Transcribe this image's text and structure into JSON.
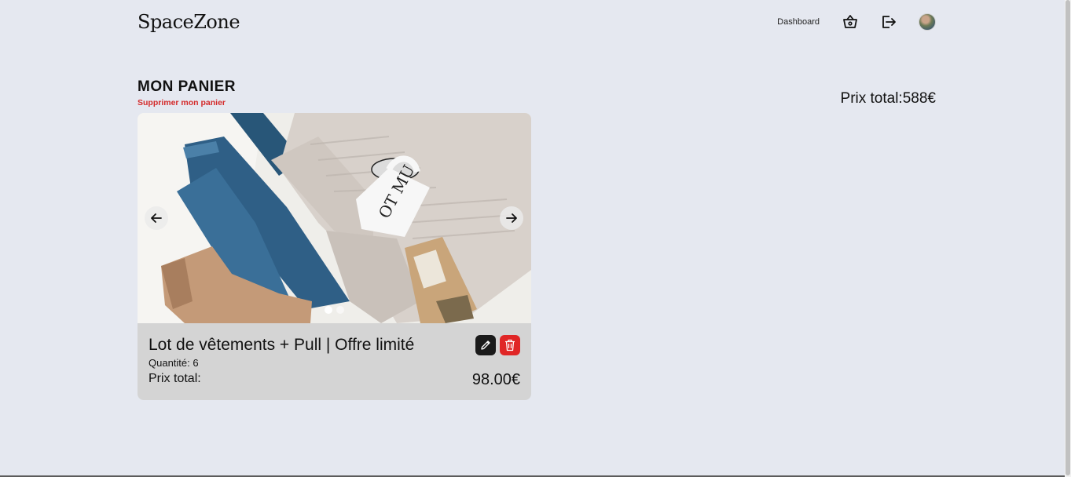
{
  "header": {
    "logo": "SpaceZone",
    "nav": {
      "dashboard_label": "Dashboard"
    },
    "icons": [
      "basket-icon",
      "logout-icon",
      "avatar"
    ]
  },
  "cart": {
    "title": "MON PANIER",
    "clear_label": "Supprimer mon panier",
    "total_label": "Prix total:",
    "total_value": "588€"
  },
  "items": [
    {
      "name": "Lot de vêtements + Pull | Offre limité",
      "quantity_label": "Quantité:",
      "quantity": "6",
      "price_label": "Prix total:",
      "price": "98.00€",
      "carousel": {
        "slide_count": 2,
        "active_slide": 1
      }
    }
  ],
  "colors": {
    "background": "#e5e8f0",
    "danger": "#e02626",
    "dark_button": "#1a1a1a",
    "card_footer": "#d4d4d4"
  }
}
